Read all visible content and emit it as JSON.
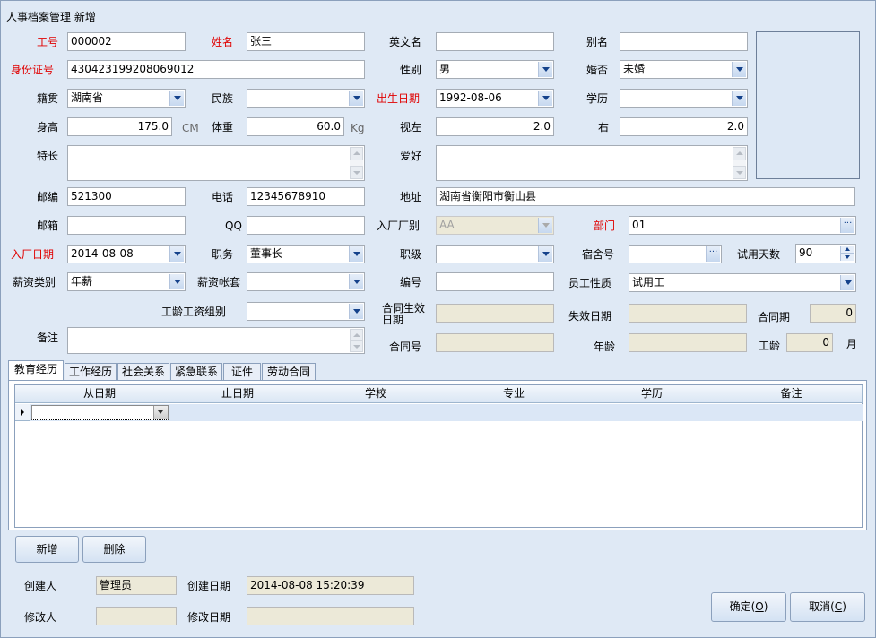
{
  "window": {
    "title": "人事档案管理 新增"
  },
  "labels": {
    "emp_no": "工号",
    "name": "姓名",
    "english_name": "英文名",
    "alias": "别名",
    "id_card": "身份证号",
    "gender": "性别",
    "marital": "婚否",
    "native_place": "籍贯",
    "ethnicity": "民族",
    "birth_date": "出生日期",
    "education": "学历",
    "height": "身高",
    "height_unit": "CM",
    "weight": "体重",
    "weight_unit": "Kg",
    "vision_left": "视左",
    "vision_right": "右",
    "specialty": "特长",
    "hobby": "爱好",
    "postcode": "邮编",
    "phone": "电话",
    "address": "地址",
    "email": "邮箱",
    "qq": "QQ",
    "factory": "入厂厂别",
    "department": "部门",
    "join_date": "入厂日期",
    "position": "职务",
    "job_level": "职级",
    "dorm_no": "宿舍号",
    "probation_days": "试用天数",
    "salary_type": "薪资类别",
    "salary_account": "薪资帐套",
    "number": "编号",
    "emp_nature": "员工性质",
    "seniority_group": "工龄工资组别",
    "contract_effective": "合同生效日期",
    "expire_date": "失效日期",
    "contract_period": "合同期",
    "remark": "备注",
    "contract_no": "合同号",
    "age": "年龄",
    "seniority": "工龄",
    "month_unit": "月"
  },
  "values": {
    "emp_no": "000002",
    "name": "张三",
    "english_name": "",
    "alias": "",
    "id_card": "430423199208069012",
    "gender": "男",
    "marital": "未婚",
    "native_place": "湖南省",
    "ethnicity": "",
    "birth_date": "1992-08-06",
    "education": "",
    "height": "175.0",
    "weight": "60.0",
    "vision_left": "2.0",
    "vision_right": "2.0",
    "postcode": "521300",
    "phone": "12345678910",
    "address": "湖南省衡阳市衡山县",
    "email": "",
    "qq": "",
    "factory": "AA",
    "department": "01",
    "join_date": "2014-08-08",
    "position": "董事长",
    "job_level": "",
    "dorm_no": "",
    "probation_days": "90",
    "salary_type": "年薪",
    "salary_account": "",
    "number": "",
    "emp_nature": "试用工",
    "seniority_group": "",
    "contract_effective": "",
    "expire_date": "",
    "contract_period": "0",
    "remark": "",
    "contract_no": "",
    "age": "",
    "seniority": "0"
  },
  "tabs": [
    "教育经历",
    "工作经历",
    "社会关系",
    "紧急联系",
    "证件",
    "劳动合同"
  ],
  "grid": {
    "columns": [
      "从日期",
      "止日期",
      "学校",
      "专业",
      "学历",
      "备注"
    ]
  },
  "buttons": {
    "add": "新增",
    "delete": "删除",
    "ok": "确定(O)",
    "ok_text": "确定(",
    "ok_key": "O",
    "ok_end": ")",
    "cancel_text": "取消(",
    "cancel_key": "C",
    "cancel_end": ")"
  },
  "footer": {
    "creator_label": "创建人",
    "creator": "管理员",
    "created_label": "创建日期",
    "created": "2014-08-08 15:20:39",
    "modifier_label": "修改人",
    "modifier": "",
    "modified_label": "修改日期",
    "modified": ""
  }
}
